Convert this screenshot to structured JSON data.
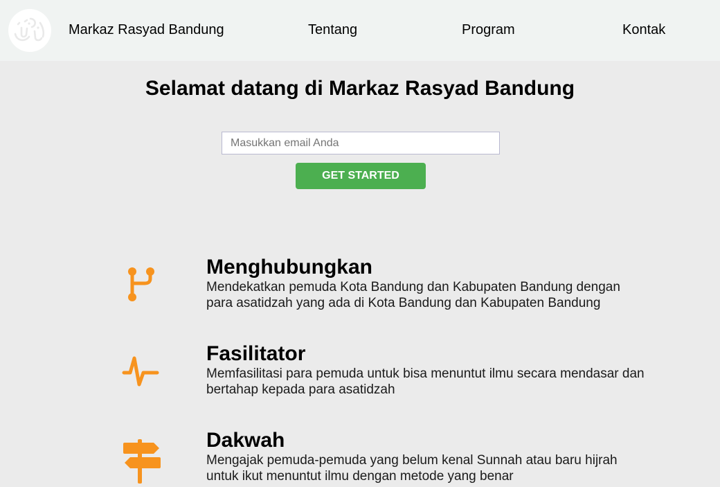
{
  "header": {
    "brand": "Markaz Rasyad Bandung",
    "nav": [
      "Tentang",
      "Program",
      "Kontak"
    ],
    "logo_icon": "arabic-calligraphy-logo"
  },
  "hero": {
    "title": "Selamat datang di Markaz Rasyad Bandung",
    "email_placeholder": "Masukkan email Anda",
    "cta_label": "GET STARTED",
    "cta_color": "#4caf50"
  },
  "features": [
    {
      "icon": "git-branch-icon",
      "title": "Menghubungkan",
      "description": "Mendekatkan pemuda Kota Bandung dan Kabupaten Bandung dengan para asatidzah yang ada di Kota Bandung dan Kabupaten Bandung"
    },
    {
      "icon": "pulse-icon",
      "title": "Fasilitator",
      "description": "Memfasilitasi para pemuda untuk bisa menuntut ilmu secara mendasar dan bertahap kepada para asatidzah"
    },
    {
      "icon": "signpost-icon",
      "title": "Dakwah",
      "description": "Mengajak pemuda-pemuda yang belum kenal Sunnah atau baru hijrah untuk ikut menuntut ilmu dengan metode yang benar"
    }
  ],
  "colors": {
    "accent": "#f7931e",
    "header_bg": "#f0f3f2",
    "page_bg": "#ebebeb"
  }
}
